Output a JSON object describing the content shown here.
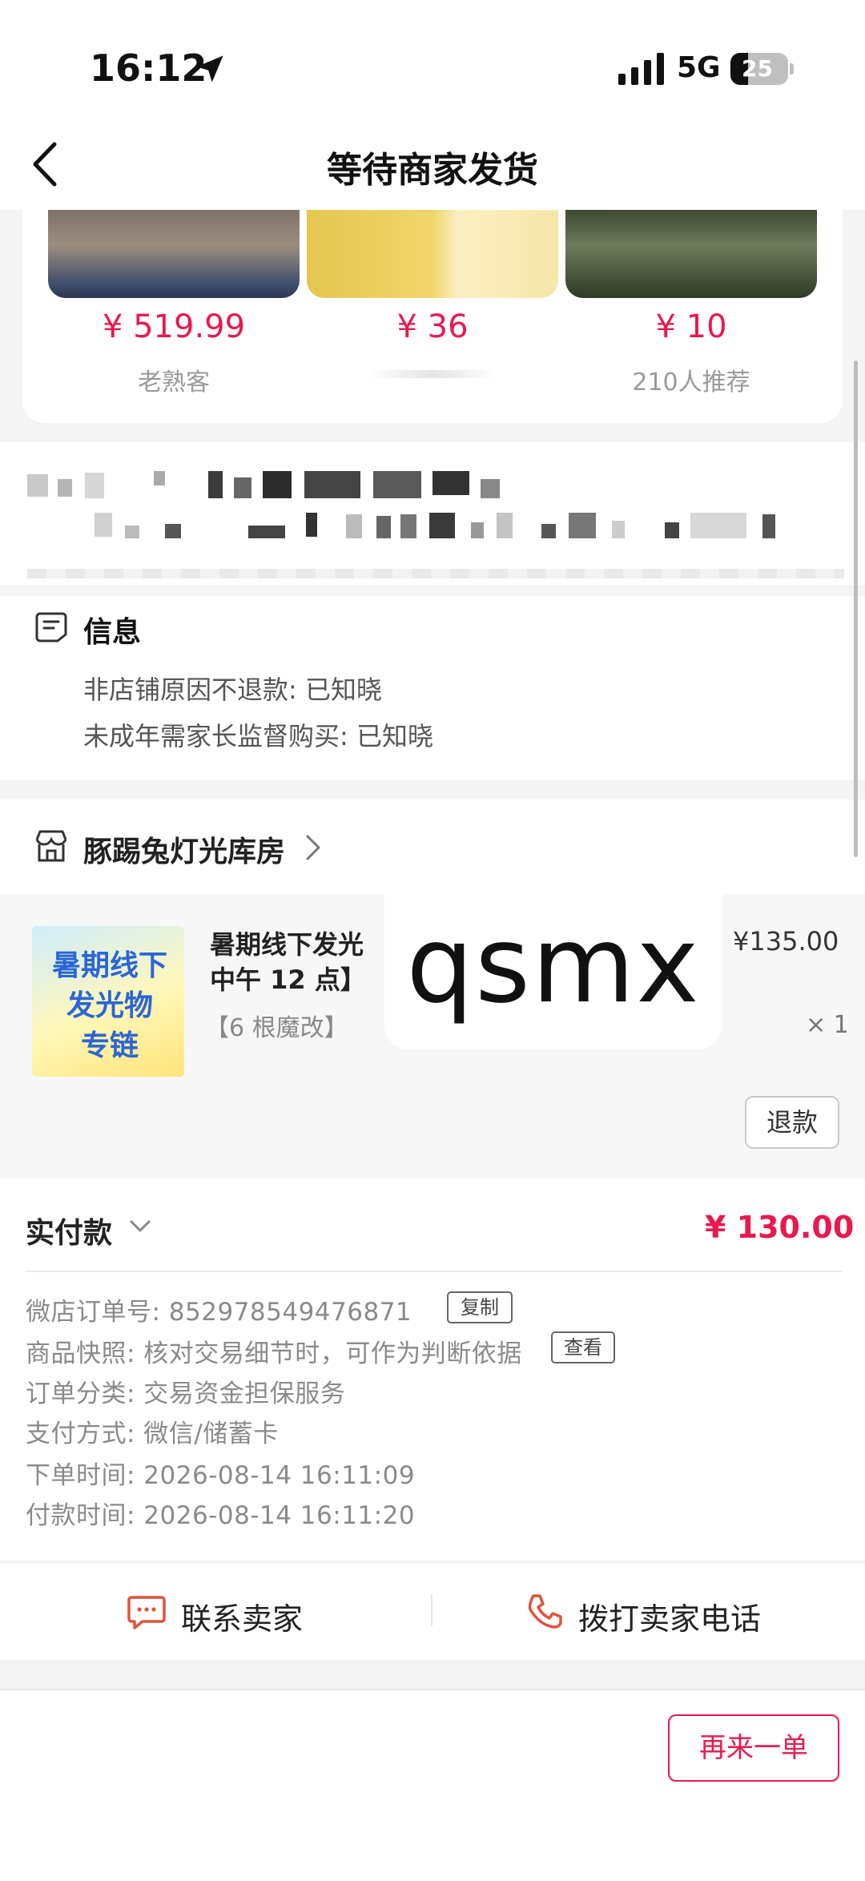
{
  "status_bar": {
    "time": "16:12",
    "network": "5G",
    "battery": "25"
  },
  "nav": {
    "title": "等待商家发货"
  },
  "recommendations": [
    {
      "price": "¥ 519.99",
      "subtitle": "老熟客"
    },
    {
      "price": "¥ 36",
      "subtitle": ""
    },
    {
      "price": "¥ 10",
      "subtitle": "210人推荐"
    }
  ],
  "info": {
    "title": "信息",
    "lines": [
      "非店铺原因不退款: 已知晓",
      "未成年需家长监督购买: 已知晓"
    ]
  },
  "shop": {
    "name": "豚踢兔灯光库房"
  },
  "product": {
    "thumb_text": [
      "暑期线下",
      "发光物",
      "专链"
    ],
    "name_line1": "暑期线下发光",
    "name_line2": "中午 12 点】",
    "spec": "【6 根魔改】",
    "price": "¥135.00",
    "quantity": "× 1",
    "refund_label": "退款",
    "overlay_text": "qsmx"
  },
  "payment": {
    "label": "实付款",
    "amount": "¥ 130.00",
    "details": [
      {
        "text": "微店订单号:  852978549476871",
        "button": "复制"
      },
      {
        "text": "商品快照: 核对交易细节时，可作为判断依据",
        "button": "查看"
      },
      {
        "text": "订单分类:  交易资金担保服务",
        "button": ""
      },
      {
        "text": "支付方式:  微信/储蓄卡",
        "button": ""
      },
      {
        "text": "下单时间:  2026-08-14 16:11:09",
        "button": ""
      },
      {
        "text": "付款时间:  2026-08-14 16:11:20",
        "button": ""
      }
    ]
  },
  "contact": {
    "chat_label": "联系卖家",
    "call_label": "拨打卖家电话"
  },
  "bottom": {
    "reorder_label": "再来一单"
  },
  "colors": {
    "accent": "#e8194e",
    "background": "#f4f4f4",
    "card": "#ffffff"
  }
}
